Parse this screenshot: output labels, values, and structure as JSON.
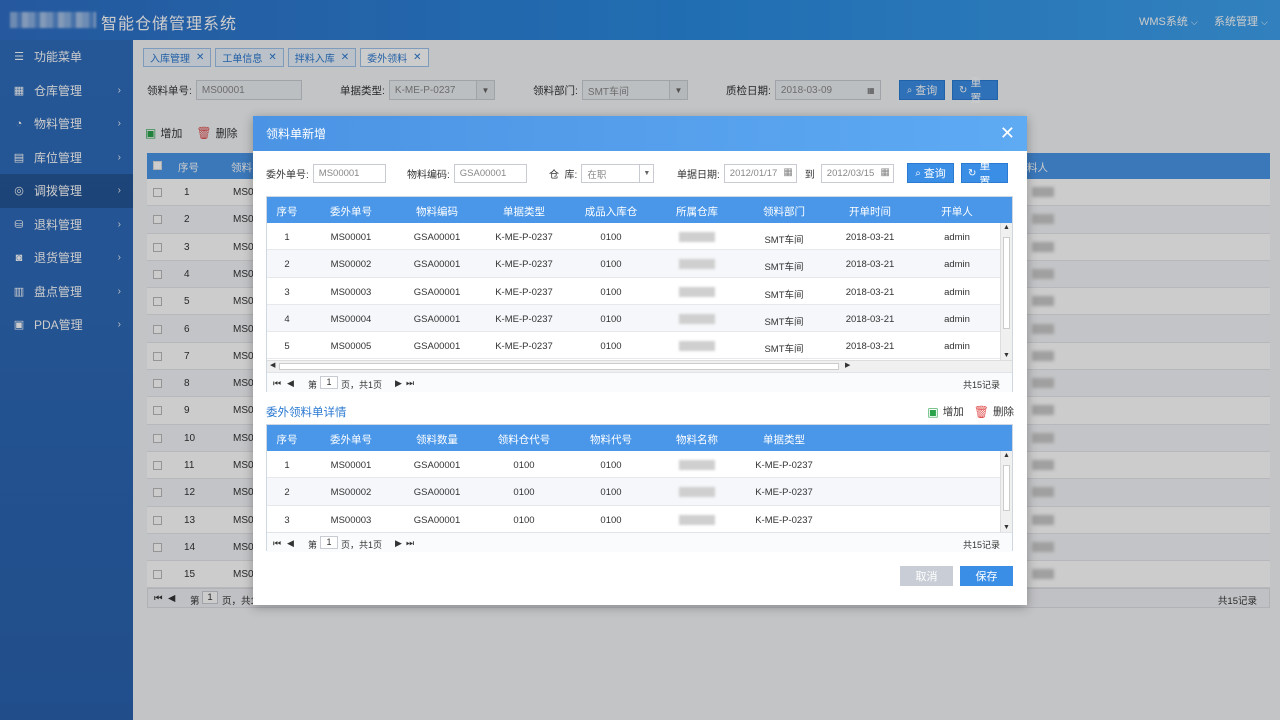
{
  "header": {
    "title": "智能仓储管理系统",
    "menus": [
      {
        "label": "WMS系统"
      },
      {
        "label": "系统管理"
      }
    ]
  },
  "sidebar": {
    "items": [
      {
        "label": "功能菜单",
        "icon": "menu-icon"
      },
      {
        "label": "仓库管理",
        "icon": "warehouse-icon"
      },
      {
        "label": "物料管理",
        "icon": "pie-icon"
      },
      {
        "label": "库位管理",
        "icon": "list-icon"
      },
      {
        "label": "调拨管理",
        "icon": "transfer-icon"
      },
      {
        "label": "退料管理",
        "icon": "database-icon"
      },
      {
        "label": "退货管理",
        "icon": "return-icon"
      },
      {
        "label": "盘点管理",
        "icon": "inventory-icon"
      },
      {
        "label": "PDA管理",
        "icon": "pda-icon"
      }
    ]
  },
  "tabs": [
    {
      "label": "入库管理"
    },
    {
      "label": "工单信息"
    },
    {
      "label": "拌料入库"
    },
    {
      "label": "委外领料"
    }
  ],
  "filters": {
    "order_no_label": "领料单号:",
    "order_no_value": "MS00001",
    "type_label": "单据类型:",
    "type_value": "K-ME-P-0237",
    "dept_label": "领料部门:",
    "dept_value": "SMT车间",
    "date_label": "质检日期:",
    "date_value": "2018-03-09",
    "query": "查询",
    "reset": "重置"
  },
  "toolbar": {
    "add": "增加",
    "delete": "删除"
  },
  "main_grid": {
    "headers": [
      "序号",
      "领料",
      "料人"
    ],
    "rows": [
      {
        "n": "1",
        "code": "MS0"
      },
      {
        "n": "2",
        "code": "MS0"
      },
      {
        "n": "3",
        "code": "MS0"
      },
      {
        "n": "4",
        "code": "MS0"
      },
      {
        "n": "5",
        "code": "MS0"
      },
      {
        "n": "6",
        "code": "MS0"
      },
      {
        "n": "7",
        "code": "MS0"
      },
      {
        "n": "8",
        "code": "MS0"
      },
      {
        "n": "9",
        "code": "MS0"
      },
      {
        "n": "10",
        "code": "MS0"
      },
      {
        "n": "11",
        "code": "MS0"
      },
      {
        "n": "12",
        "code": "MS0"
      },
      {
        "n": "13",
        "code": "MS0"
      },
      {
        "n": "14",
        "code": "MS0"
      },
      {
        "n": "15",
        "code": "MS0"
      }
    ],
    "pager_prefix": "第",
    "page": "1",
    "pager_suffix": "页，共1",
    "total": "共15记录"
  },
  "modal": {
    "title": "领料单新增",
    "filters": {
      "wo_label": "委外单号:",
      "wo_value": "MS00001",
      "mat_label": "物料编码:",
      "mat_value": "GSA00001",
      "wh_label": "仓  库:",
      "wh_value": "在职",
      "date_label": "单据日期:",
      "date_from": "2012/01/17",
      "to_label": "到",
      "date_to": "2012/03/15",
      "query": "查询",
      "reset": "重置"
    },
    "table1": {
      "headers": [
        "序号",
        "委外单号",
        "物料编码",
        "单据类型",
        "成品入库仓",
        "所属仓库",
        "领料部门",
        "开单时间",
        "开单人"
      ],
      "rows": [
        [
          "1",
          "MS00001",
          "GSA00001",
          "K-ME-P-0237",
          "0100",
          "SMT车间",
          "2018-03-21",
          "admin"
        ],
        [
          "2",
          "MS00002",
          "GSA00001",
          "K-ME-P-0237",
          "0100",
          "SMT车间",
          "2018-03-21",
          "admin"
        ],
        [
          "3",
          "MS00003",
          "GSA00001",
          "K-ME-P-0237",
          "0100",
          "SMT车间",
          "2018-03-21",
          "admin"
        ],
        [
          "4",
          "MS00004",
          "GSA00001",
          "K-ME-P-0237",
          "0100",
          "SMT车间",
          "2018-03-21",
          "admin"
        ],
        [
          "5",
          "MS00005",
          "GSA00001",
          "K-ME-P-0237",
          "0100",
          "SMT车间",
          "2018-03-21",
          "admin"
        ]
      ],
      "pager_prefix": "第",
      "page": "1",
      "pager_suffix": "页，共1页",
      "total": "共15记录"
    },
    "detail_title": "委外领料单详情",
    "detail_tools": {
      "add": "增加",
      "delete": "删除"
    },
    "table2": {
      "headers": [
        "序号",
        "委外单号",
        "领料数量",
        "领料仓代号",
        "物料代号",
        "物料名称",
        "单据类型"
      ],
      "rows": [
        [
          "1",
          "MS00001",
          "GSA00001",
          "0100",
          "0100",
          "K-ME-P-0237"
        ],
        [
          "2",
          "MS00002",
          "GSA00001",
          "0100",
          "0100",
          "K-ME-P-0237"
        ],
        [
          "3",
          "MS00003",
          "GSA00001",
          "0100",
          "0100",
          "K-ME-P-0237"
        ]
      ],
      "pager_prefix": "第",
      "page": "1",
      "pager_suffix": "页，共1页",
      "total": "共15记录"
    },
    "cancel": "取消",
    "save": "保存"
  },
  "colors": {
    "accent": "#3a8ee6",
    "header_bg": "#2a8ae0",
    "sidebar_bg": "#2f6dbd"
  }
}
